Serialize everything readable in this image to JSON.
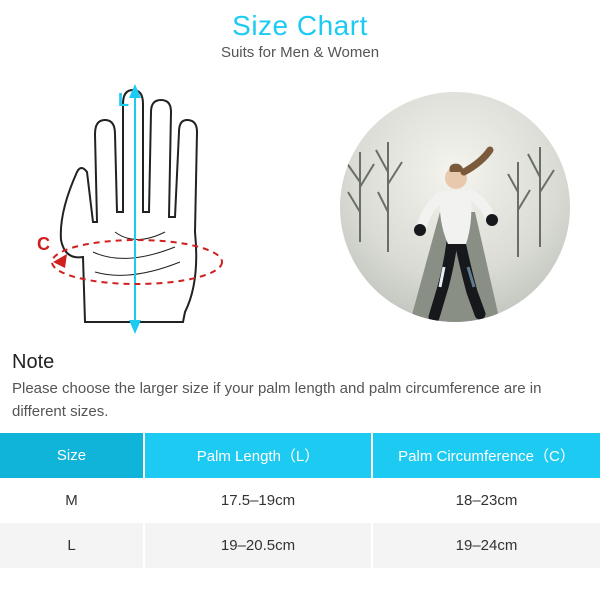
{
  "colors": {
    "accent": "#1dcbf2",
    "accent_dark": "#0fb4d8",
    "red": "#cf1f1f"
  },
  "header": {
    "title": "Size Chart",
    "subtitle": "Suits for Men & Women"
  },
  "diagram": {
    "length_label": "L",
    "circumference_label": "C",
    "hand_alt": "hand-measurement-diagram",
    "photo_alt": "woman-running-outdoors"
  },
  "note": {
    "heading": "Note",
    "text": "Please choose the larger size if your palm length and palm circumference are in different sizes."
  },
  "table": {
    "headers": {
      "size": "Size",
      "length": "Palm Length（L）",
      "circ": "Palm Circumference（C）"
    },
    "rows": [
      {
        "size": "M",
        "length": "17.5–19cm",
        "circ": "18–23cm"
      },
      {
        "size": "L",
        "length": "19–20.5cm",
        "circ": "19–24cm"
      }
    ]
  }
}
